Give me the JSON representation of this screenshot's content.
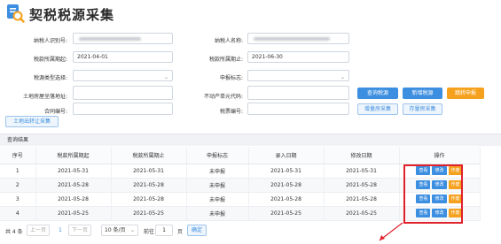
{
  "header": {
    "title": "契税税源采集",
    "logo_icon": "search-document-icon"
  },
  "form": {
    "taxpayer_id": {
      "label": "纳税人识别号:",
      "value": ""
    },
    "taxpayer_name": {
      "label": "纳税人名称:",
      "value": ""
    },
    "period_start": {
      "label": "税款所属期起:",
      "value": "2021-04-01"
    },
    "period_end": {
      "label": "税款所属期止:",
      "value": "2021-06-30"
    },
    "source_type": {
      "label": "税源类型选择:",
      "value": ""
    },
    "declare_flag": {
      "label": "申报标志:",
      "value": ""
    },
    "land_address": {
      "label": "土地房屋坐落地址:",
      "value": ""
    },
    "property_unit_code": {
      "label": "不动产单元代码:",
      "value": ""
    },
    "contract_no": {
      "label": "合同编号:",
      "value": ""
    },
    "ticket_no": {
      "label": "税票编号:",
      "value": ""
    }
  },
  "buttons": {
    "query": "查询税源",
    "add": "新增税源",
    "jump_declare": "跳转申报",
    "incremental_collect": "增量房采集",
    "existing_collect": "存量房采集",
    "land_transfer_collect": "土地出转让采集"
  },
  "results": {
    "title": "查询结果",
    "columns": [
      "序号",
      "税款所属期起",
      "税款所属期止",
      "申报标志",
      "录入日期",
      "修改日期",
      "操作"
    ],
    "rows": [
      {
        "no": "1",
        "start": "2021-05-31",
        "end": "2021-05-31",
        "flag": "未申报",
        "entry": "2021-05-31",
        "modified": "2021-05-31"
      },
      {
        "no": "2",
        "start": "2021-05-28",
        "end": "2021-05-28",
        "flag": "未申报",
        "entry": "2021-05-28",
        "modified": "2021-05-28"
      },
      {
        "no": "3",
        "start": "2021-05-28",
        "end": "2021-05-28",
        "flag": "未申报",
        "entry": "2021-05-28",
        "modified": "2021-05-28"
      },
      {
        "no": "4",
        "start": "2021-05-25",
        "end": "2021-05-25",
        "flag": "未申报",
        "entry": "2021-05-25",
        "modified": "2021-05-25"
      }
    ],
    "actions": {
      "view": "查看",
      "edit": "修改",
      "void": "作废"
    }
  },
  "pager": {
    "total": "共 4 条",
    "prev": "上一页",
    "current": "1",
    "next": "下一页",
    "page_size": "10 条/页",
    "goto": "前往",
    "goto_value": "1",
    "page_unit": "页",
    "confirm": "确定"
  },
  "colors": {
    "primary": "#3c8ee0",
    "warning": "#f5a11d",
    "highlight": "#e0202a"
  }
}
